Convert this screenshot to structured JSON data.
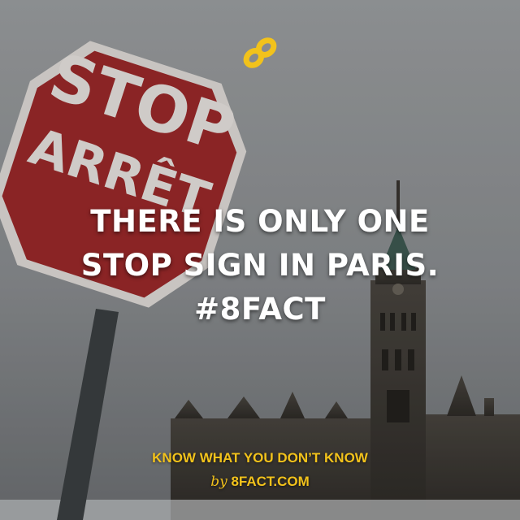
{
  "fact": {
    "line1": "THERE IS ONLY ONE",
    "line2": "STOP SIGN IN PARIS.",
    "hashtag": "#8FACT"
  },
  "sign": {
    "word_top": "STOP",
    "word_bottom": "ARRÊT"
  },
  "footer": {
    "tagline": "KNOW WHAT YOU DON’T KNOW",
    "by": "by",
    "site": "8FACT.COM"
  },
  "icons": {
    "logo": "infinity-eight-logo-icon"
  },
  "colors": {
    "accent": "#f2c21b",
    "sign_red": "#9e2a2b",
    "text": "#ffffff"
  }
}
